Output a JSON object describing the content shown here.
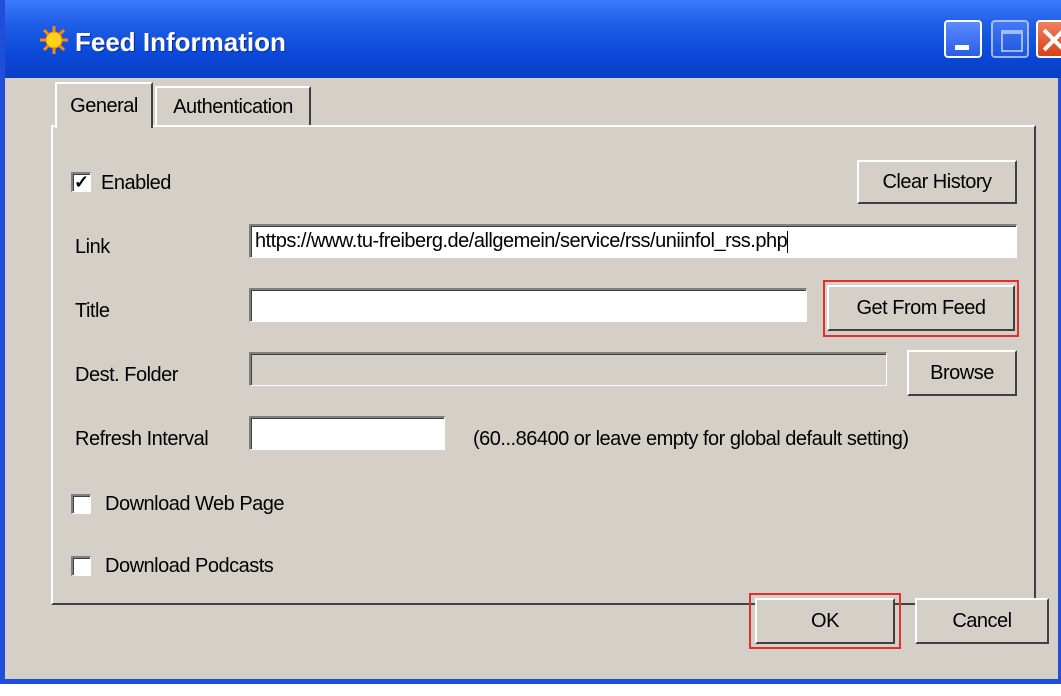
{
  "window": {
    "title": "Feed Information",
    "icon": "sun-icon",
    "accent_color": "#0a48d8"
  },
  "tabs": [
    {
      "label": "General",
      "active": true
    },
    {
      "label": "Authentication",
      "active": false
    }
  ],
  "general": {
    "enabled_label": "Enabled",
    "enabled_checked": true,
    "clear_history_label": "Clear History",
    "link_label": "Link",
    "link_value": "https://www.tu-freiberg.de/allgemein/service/rss/uniinfol_rss.php",
    "title_label": "Title",
    "title_value": "",
    "get_from_feed_label": "Get From Feed",
    "dest_folder_label": "Dest. Folder",
    "dest_folder_value": "",
    "browse_label": "Browse",
    "refresh_label": "Refresh Interval",
    "refresh_value": "",
    "refresh_hint": "(60...86400 or leave empty for global default setting)",
    "download_web_page_label": "Download Web Page",
    "download_web_page_checked": false,
    "download_podcasts_label": "Download Podcasts",
    "download_podcasts_checked": false
  },
  "footer": {
    "ok_label": "OK",
    "cancel_label": "Cancel"
  },
  "highlight_color": "#e03030"
}
